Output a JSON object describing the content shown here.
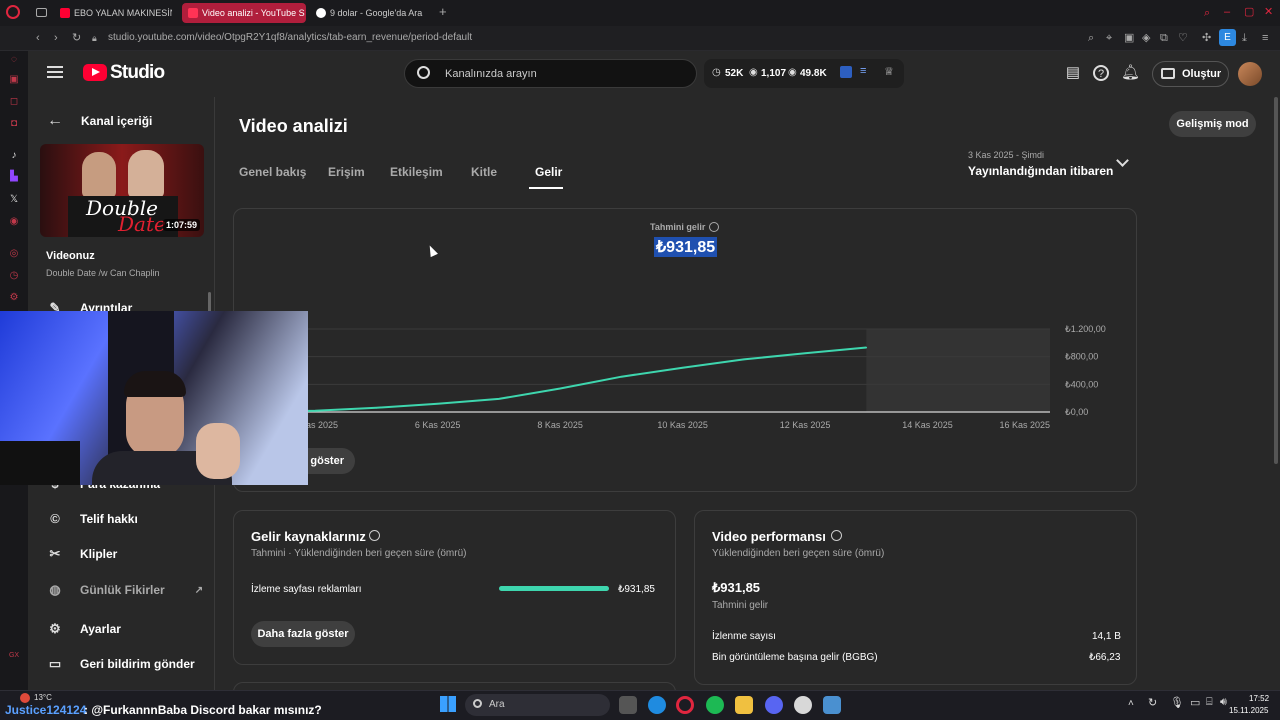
{
  "browser": {
    "tabs": [
      {
        "label": "EBO YALAN MAKINESİNDE",
        "active": false
      },
      {
        "label": "Video analizi - YouTube S",
        "active": true
      },
      {
        "label": "9 dolar - Google'da Ara",
        "active": false
      }
    ],
    "new_tab": "+",
    "url": "studio.youtube.com/video/OtpgR2Y1qf8/analytics/tab-earn_revenue/period-default",
    "extension_badge": "E"
  },
  "header": {
    "logo_text": "Studio",
    "search_placeholder": "Kanalınızda arayın",
    "stats": {
      "subs": "52K",
      "views_live": "1,107",
      "views": "49.8K"
    },
    "create_label": "Oluştur"
  },
  "sidebar": {
    "back_label": "Kanal içeriği",
    "video_duration": "1:07:59",
    "thumb_title_a": "Double",
    "thumb_title_b": "Date",
    "your_video_label": "Videonuz",
    "video_title": "Double Date /w Can Chaplin",
    "items": [
      {
        "label": "Ayrıntılar",
        "icon": "pencil-icon"
      },
      {
        "label": "Para kazanma",
        "icon": "dollar-icon"
      },
      {
        "label": "Telif hakkı",
        "icon": "copyright-icon"
      },
      {
        "label": "Klipler",
        "icon": "scissors-icon"
      },
      {
        "label": "Günlük Fikirler",
        "icon": "ideas-icon"
      },
      {
        "label": "Ayarlar",
        "icon": "gear-icon"
      },
      {
        "label": "Geri bildirim gönder",
        "icon": "feedback-icon"
      }
    ]
  },
  "main": {
    "page_title": "Video analizi",
    "advanced_mode": "Gelişmiş mod",
    "tabs": [
      "Genel bakış",
      "Erişim",
      "Etkileşim",
      "Kitle",
      "Gelir"
    ],
    "active_tab": "Gelir",
    "period_range": "3 Kas 2025 - Şimdi",
    "period_label": "Yayınlandığından itibaren",
    "metric_label": "Tahmini gelir",
    "metric_value": "₺931,85",
    "show_more_partial": "a göster"
  },
  "chart_data": {
    "type": "line",
    "x_tick_labels": [
      "4 Kas 2025",
      "6 Kas 2025",
      "8 Kas 2025",
      "10 Kas 2025",
      "12 Kas 2025",
      "14 Kas 2025",
      "16 Kas 2025"
    ],
    "y_tick_labels": [
      "₺1.200,00",
      "₺800,00",
      "₺400,00",
      "₺0,00"
    ],
    "ylim": [
      0,
      1200
    ],
    "xlim_days": [
      3,
      16
    ],
    "series": [
      {
        "color": "#3ed6ae",
        "x": [
          3,
          4,
          5,
          6,
          7,
          8,
          9,
          10,
          11,
          12,
          13
        ],
        "y": [
          5,
          18,
          60,
          120,
          190,
          340,
          510,
          640,
          760,
          850,
          931.85
        ]
      }
    ],
    "future_shade_from_day": 13,
    "grid": true
  },
  "revenue_sources": {
    "title": "Gelir kaynaklarınız",
    "subtitle": "Tahmini · Yüklendiğinden beri geçen süre (ömrü)",
    "rows": [
      {
        "label": "İzleme sayfası reklamları",
        "value": "₺931,85",
        "fraction": 1.0
      }
    ],
    "show_more": "Daha fazla göster"
  },
  "performance": {
    "title": "Video performansı",
    "subtitle": "Yüklendiğinden beri geçen süre (ömrü)",
    "revenue": "₺931,85",
    "revenue_label": "Tahmini gelir",
    "rows": [
      {
        "label": "İzlenme sayısı",
        "value": "14,1 B"
      },
      {
        "label": "Bin görüntüleme başına gelir (BGBG)",
        "value": "₺66,23"
      }
    ]
  },
  "taskbar": {
    "weather": "13°C",
    "chat_user": "Justice124124",
    "chat_message": ": @FurkannnBaba Discord bakar mısınız?",
    "search_placeholder": "Ara",
    "time": "17:52",
    "date": "15.11.2025"
  },
  "colors": {
    "accent_green": "#3ed6ae",
    "youtube_red": "#ff0033",
    "opera_red": "#b01e3c",
    "highlight": "#1f50b0"
  }
}
